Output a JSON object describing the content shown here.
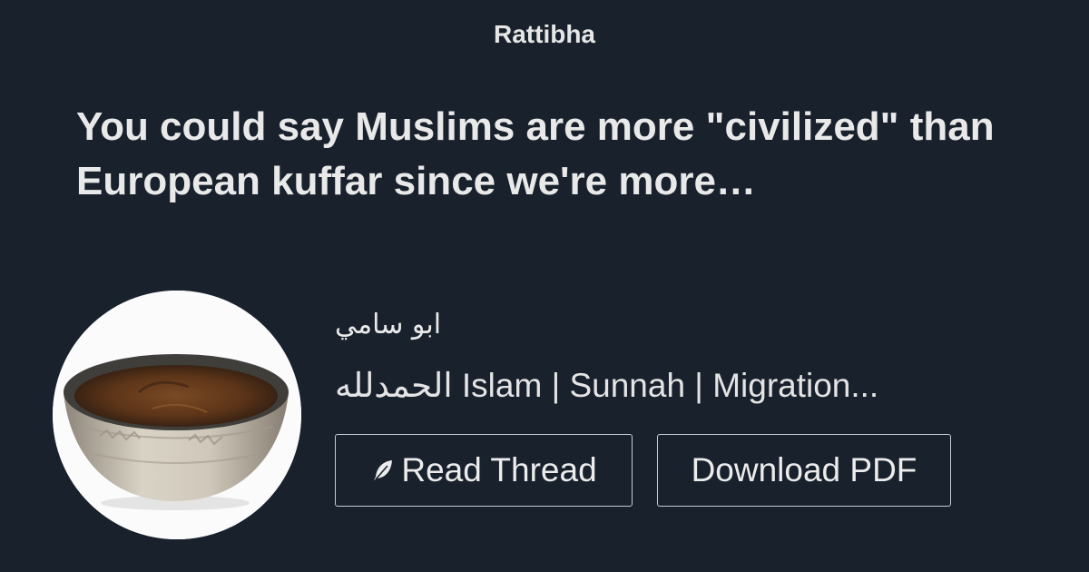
{
  "brand": {
    "name": "Rattibha"
  },
  "thread": {
    "title": "You could say Muslims are more \"civilized\" than European kuffar since we're more…"
  },
  "author": {
    "name": "ابو سامي",
    "bio": "الحمدلله Islam | Sunnah | Migration..."
  },
  "actions": {
    "read_thread_label": "Read Thread",
    "read_thread_icon": "feather-icon",
    "download_pdf_label": "Download PDF"
  },
  "colors": {
    "background": "#19212d",
    "text": "#e9e9e9",
    "button_border": "#c9ccd1"
  }
}
